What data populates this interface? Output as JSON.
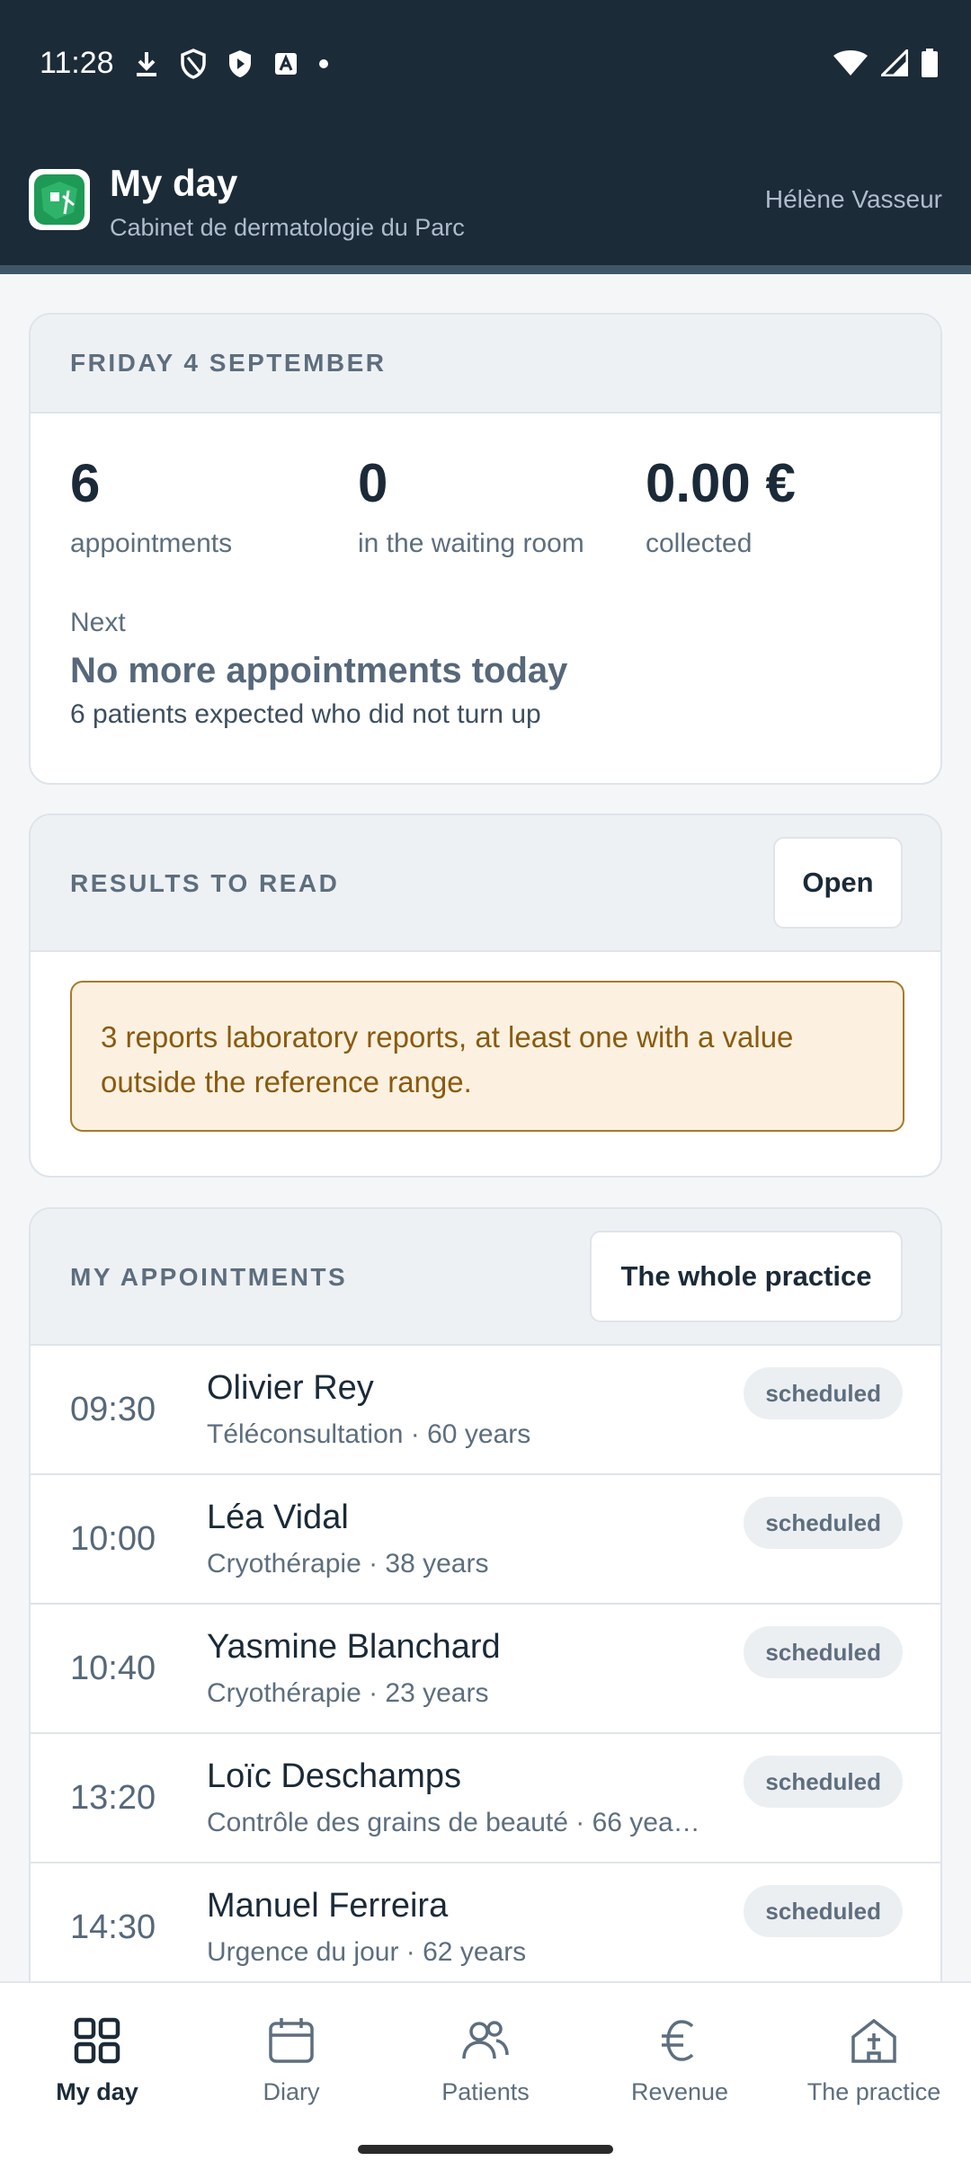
{
  "status_bar": {
    "time": "11:28"
  },
  "header": {
    "title": "My day",
    "subtitle": "Cabinet de dermatologie du Parc",
    "user": "Hélène Vasseur"
  },
  "day": {
    "heading": "FRIDAY 4 SEPTEMBER",
    "stats": [
      {
        "value": "6",
        "label": "appointments"
      },
      {
        "value": "0",
        "label": "in the waiting room"
      },
      {
        "value": "0.00 €",
        "label": "collected"
      }
    ],
    "next_label": "Next",
    "next_title": "No more appointments today",
    "next_sub": "6 patients expected who did not turn up"
  },
  "results": {
    "heading": "RESULTS TO READ",
    "open_label": "Open",
    "alert": "3 reports laboratory reports, at least one with a value outside the reference range."
  },
  "appointments": {
    "heading": "MY APPOINTMENTS",
    "filter_label": "The whole practice",
    "items": [
      {
        "time": "09:30",
        "name": "Olivier Rey",
        "detail": "Téléconsultation · 60 years",
        "status": "scheduled"
      },
      {
        "time": "10:00",
        "name": "Léa Vidal",
        "detail": "Cryothérapie · 38 years",
        "status": "scheduled"
      },
      {
        "time": "10:40",
        "name": "Yasmine Blanchard",
        "detail": "Cryothérapie · 23 years",
        "status": "scheduled"
      },
      {
        "time": "13:20",
        "name": "Loïc Deschamps",
        "detail": "Contrôle des grains de beauté · 66 yea…",
        "status": "scheduled"
      },
      {
        "time": "14:30",
        "name": "Manuel Ferreira",
        "detail": "Urgence du jour · 62 years",
        "status": "scheduled"
      }
    ]
  },
  "nav": {
    "items": [
      {
        "label": "My day",
        "icon": "grid-icon",
        "active": true
      },
      {
        "label": "Diary",
        "icon": "calendar-icon",
        "active": false
      },
      {
        "label": "Patients",
        "icon": "people-icon",
        "active": false
      },
      {
        "label": "Revenue",
        "icon": "euro-icon",
        "active": false
      },
      {
        "label": "The practice",
        "icon": "practice-icon",
        "active": false
      }
    ]
  },
  "colors": {
    "header_bg": "#1c2b38",
    "alert_bg": "#fcf1e0",
    "alert_border": "#a77a2a",
    "badge_bg": "#eceff2"
  }
}
